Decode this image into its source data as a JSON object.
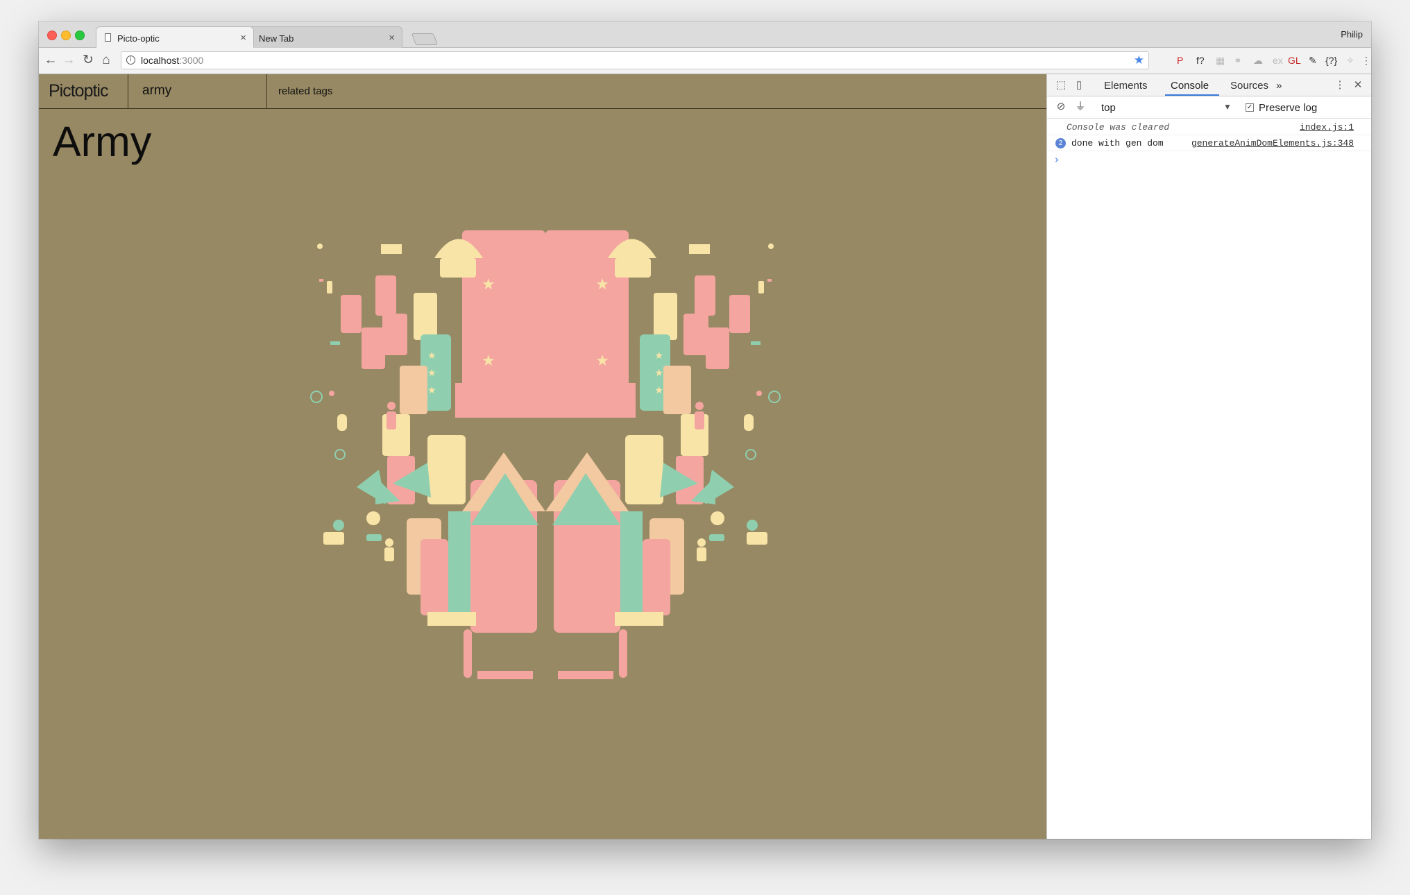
{
  "browser": {
    "tabs": [
      {
        "title": "Picto-optic",
        "close": "×"
      },
      {
        "title": "New Tab",
        "close": "×"
      }
    ],
    "profile": "Philip",
    "address": {
      "host": "localhost",
      "port": ":3000",
      "info": "i"
    },
    "nav": {
      "back": "←",
      "forward": "→",
      "reload": "↻",
      "home": "⌂"
    },
    "bookmark_star": "★",
    "extensions": [
      {
        "name": "pinterest-icon",
        "glyph": "P",
        "color": "#cb2027"
      },
      {
        "name": "function-icon",
        "glyph": "f?",
        "color": "#333333"
      },
      {
        "name": "grid-extension-icon",
        "glyph": "▦",
        "color": "#bbbbbb"
      },
      {
        "name": "link-extension-icon",
        "glyph": "⚭",
        "color": "#bbbbbb"
      },
      {
        "name": "cloud-extension-icon",
        "glyph": "☁",
        "color": "#aaaaaa"
      },
      {
        "name": "ex-extension-icon",
        "glyph": "ex",
        "color": "#bbbbbb"
      },
      {
        "name": "gl-extension-icon",
        "glyph": "GL",
        "color": "#c62828"
      },
      {
        "name": "eyedropper-icon",
        "glyph": "✎",
        "color": "#333333"
      },
      {
        "name": "json-extension-icon",
        "glyph": "{?}",
        "color": "#333333"
      },
      {
        "name": "puzzle-extension-icon",
        "glyph": "✧",
        "color": "#bbbbbb"
      },
      {
        "name": "menu-icon",
        "glyph": "⋮",
        "color": "#555555"
      }
    ]
  },
  "site": {
    "logo": "Pictoptic",
    "search_term": "army",
    "related_label": "related tags",
    "title": "Army",
    "art_colors": {
      "pink": "#f4a5a0",
      "cream": "#f9e4a8",
      "mint": "#8fcfaf",
      "peach": "#f2c9a0",
      "background": "#978963"
    }
  },
  "devtools": {
    "tabs": [
      "Elements",
      "Console",
      "Sources"
    ],
    "active_tab": "Console",
    "more": "»",
    "context": "top",
    "context_arrow": "▼",
    "preserve_log": {
      "label": "Preserve log",
      "checked": true,
      "mark": "✓"
    },
    "log": [
      {
        "message": "Console was cleared",
        "source": "index.js:1"
      },
      {
        "message": "done with gen dom",
        "source": "generateAnimDomElements.js:348",
        "count": "2"
      }
    ],
    "prompt": "›"
  }
}
